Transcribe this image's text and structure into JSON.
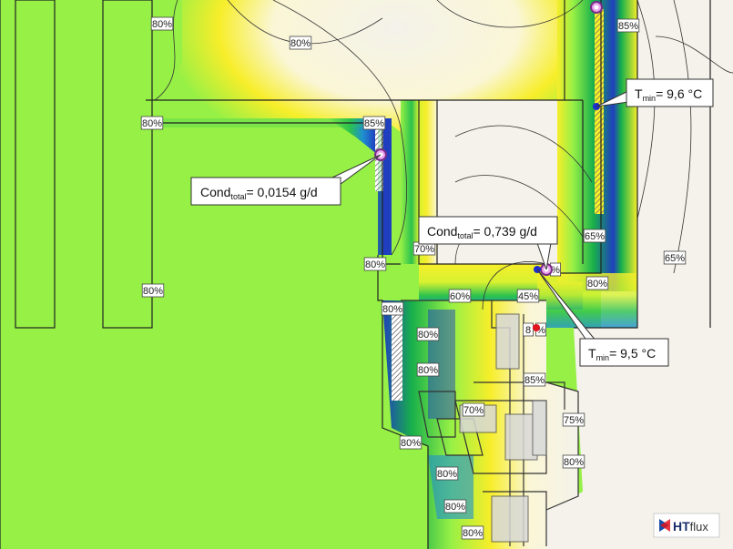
{
  "colors": {
    "wall": "#96f046",
    "frame": "#f4f2ea",
    "blue": "#1f3fbf",
    "green": "#12b84a",
    "yellow": "#f7ee2a",
    "pale": "#faf6d6",
    "red": "#e2141e"
  },
  "humidity_labels": [
    {
      "text": "80%"
    },
    {
      "text": "80%"
    },
    {
      "text": "80%"
    },
    {
      "text": "85%"
    },
    {
      "text": "80%"
    },
    {
      "text": "70%"
    },
    {
      "text": "80%"
    },
    {
      "text": "80%"
    },
    {
      "text": "60%"
    },
    {
      "text": "45%"
    },
    {
      "text": "80%"
    },
    {
      "text": "80%"
    },
    {
      "text": "85%"
    },
    {
      "text": "70%"
    },
    {
      "text": "75%"
    },
    {
      "text": "80%"
    },
    {
      "text": "80%"
    },
    {
      "text": "80%"
    },
    {
      "text": "80%"
    },
    {
      "text": "80%"
    },
    {
      "text": "85%"
    },
    {
      "text": "65%"
    },
    {
      "text": "65%"
    },
    {
      "text": "80%"
    },
    {
      "text": "8"
    },
    {
      "text": "%"
    },
    {
      "text": "%"
    }
  ],
  "callouts": {
    "cond_left": {
      "prefix": "Cond",
      "sub": "total",
      "value": "= 0,0154 g/d"
    },
    "cond_mid": {
      "prefix": "Cond",
      "sub": "total",
      "value": "= 0,739 g/d"
    },
    "tmin_top": {
      "prefix": "T",
      "sub": "min",
      "value": "= 9,6 °C"
    },
    "tmin_bottom": {
      "prefix": "T",
      "sub": "min",
      "value": "= 9,5 °C"
    }
  },
  "logo": {
    "brand": "HT",
    "suffix": "flux"
  }
}
